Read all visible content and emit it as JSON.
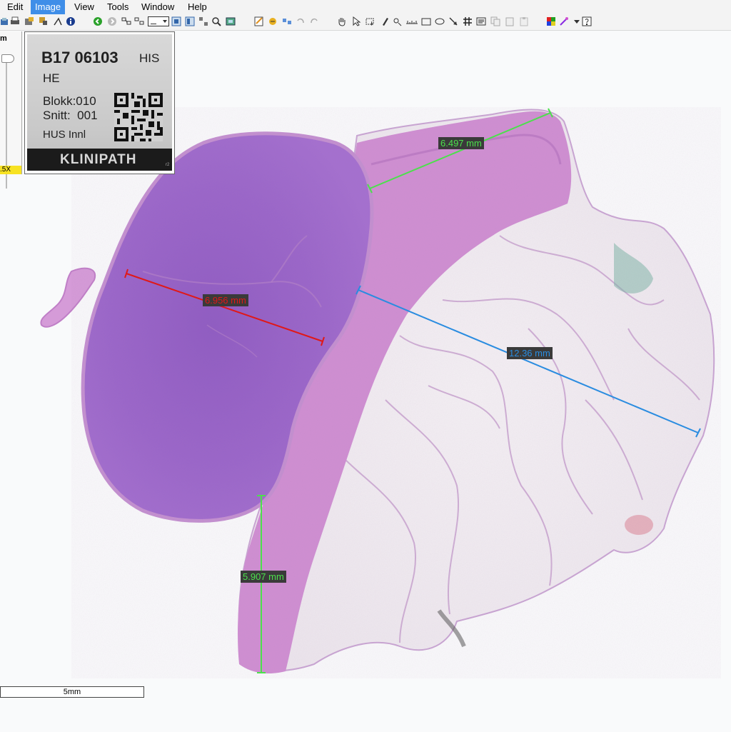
{
  "menu": {
    "items": [
      {
        "label": "Edit"
      },
      {
        "label": "Image",
        "active": true
      },
      {
        "label": "View"
      },
      {
        "label": "Tools"
      },
      {
        "label": "Window"
      },
      {
        "label": "Help"
      }
    ]
  },
  "toolbar": {
    "icons": [
      "open-icon",
      "print-icon",
      "export-icon",
      "zoom-fit-icon",
      "info-icon",
      "back-icon",
      "forward-icon",
      "layout-icon",
      "layout2-icon",
      "view-mode-dropdown",
      "single-view-icon",
      "dual-view-icon",
      "grid-view-icon",
      "magnifier-icon",
      "snapshot-icon",
      "annotate-icon",
      "stitch-icon",
      "sync-icon",
      "undo-icon",
      "redo-icon",
      "pan-icon",
      "select-icon",
      "select-region-icon",
      "pen-icon",
      "probe-icon",
      "ruler-icon",
      "rectangle-icon",
      "ellipse-icon",
      "arrow-icon",
      "grid-icon",
      "text-icon",
      "copy-icon",
      "paste-icon",
      "color-icon",
      "magic-icon",
      "dropdown-icon",
      "help-icon"
    ]
  },
  "navigator": {
    "label_fragment": "m",
    "zoom_fragment": ".5X"
  },
  "slide_label": {
    "case_id": "B17 06103",
    "dept": "HIS",
    "stain": "HE",
    "block": "Blokk:010",
    "section": "Snitt:  001",
    "site": "HUS Innl",
    "brand": "KLINIPATH",
    "corner_mark": "r2"
  },
  "measurements": [
    {
      "value": "6.497 mm",
      "color": "#4ce04c"
    },
    {
      "value": "6.956 mm",
      "color": "#e01818"
    },
    {
      "value": "12.36 mm",
      "color": "#2a8ce0"
    },
    {
      "value": "5.907 mm",
      "color": "#4ce04c"
    }
  ],
  "scalebar": {
    "label": "5mm"
  }
}
